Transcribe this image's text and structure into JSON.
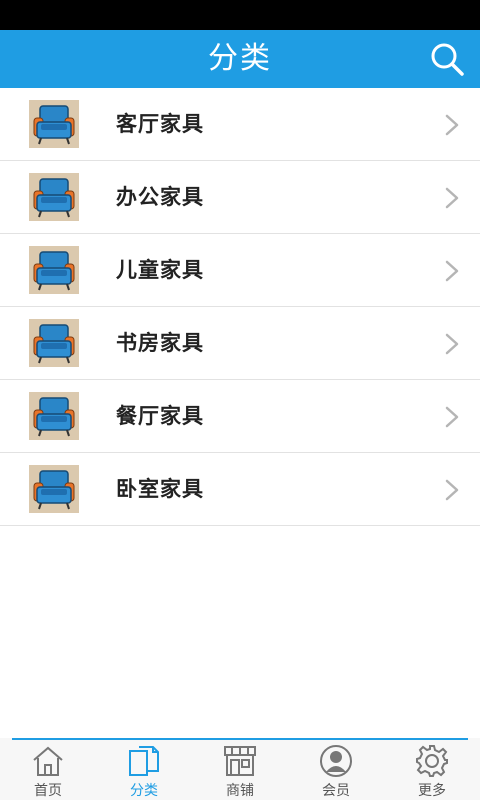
{
  "header": {
    "title": "分类",
    "icon": "search-icon"
  },
  "categories": [
    {
      "label": "客厅家具",
      "icon": "armchair-icon"
    },
    {
      "label": "办公家具",
      "icon": "armchair-icon"
    },
    {
      "label": "儿童家具",
      "icon": "armchair-icon"
    },
    {
      "label": "书房家具",
      "icon": "armchair-icon"
    },
    {
      "label": "餐厅家具",
      "icon": "armchair-icon"
    },
    {
      "label": "卧室家具",
      "icon": "armchair-icon"
    }
  ],
  "tabs": [
    {
      "label": "首页",
      "icon": "home-icon",
      "active": false
    },
    {
      "label": "分类",
      "icon": "category-icon",
      "active": true
    },
    {
      "label": "商铺",
      "icon": "store-icon",
      "active": false
    },
    {
      "label": "会员",
      "icon": "member-icon",
      "active": false
    },
    {
      "label": "更多",
      "icon": "gear-icon",
      "active": false
    }
  ],
  "colors": {
    "accent": "#1f9de3",
    "header_bg": "#1f9de3",
    "status_bar": "#000000",
    "inactive_tab": "#555555"
  }
}
